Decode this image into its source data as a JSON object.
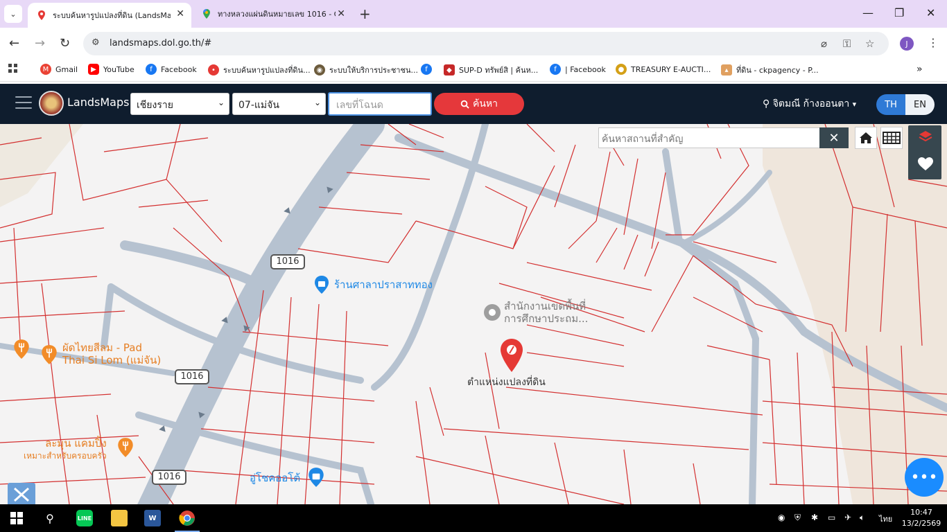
{
  "browser": {
    "tabs": [
      {
        "title": "ระบบค้นหารูปแปลงที่ดิน (LandsMap",
        "active": true
      },
      {
        "title": "ทางหลวงแผ่นดินหมายเลข 1016 - G",
        "active": false
      }
    ],
    "url": "landsmaps.dol.go.th/#",
    "profile_initial": "J"
  },
  "bookmarks": [
    {
      "label": "Gmail",
      "icon": "gmail-icon"
    },
    {
      "label": "YouTube",
      "icon": "youtube-icon"
    },
    {
      "label": "Facebook",
      "icon": "facebook-icon"
    },
    {
      "label": "ระบบค้นหารูปแปลงที่ดิน...",
      "icon": "map-pin-icon"
    },
    {
      "label": "ระบบให้บริการประชาชน...",
      "icon": "seal-icon"
    },
    {
      "label": "",
      "icon": "facebook-icon"
    },
    {
      "label": "SUP-D ทรัพย์สิ | ค้นห...",
      "icon": "sup-icon"
    },
    {
      "label": "| Facebook",
      "icon": "facebook-icon"
    },
    {
      "label": "TREASURY E-AUCTI...",
      "icon": "treasury-icon"
    },
    {
      "label": "ที่ดิน - ckpagency - P...",
      "icon": "ck-icon"
    }
  ],
  "app": {
    "brand": "LandsMaps",
    "province": "เชียงราย",
    "district": "07-แม่จัน",
    "deed_placeholder": "เลขที่โฉนด",
    "search_label": "ค้นหา",
    "user_name": "จิตมณี ก้างออนตา",
    "lang_th": "TH",
    "lang_en": "EN"
  },
  "map": {
    "place_search_placeholder": "ค้นหาสถานที่สำคัญ",
    "road_shields": [
      "1016",
      "1016",
      "1016"
    ],
    "pois": [
      {
        "name": "ร้านศาลาปราสาททอง",
        "color": "#1e88e5"
      },
      {
        "name_line1": "สำนักงานเขตพื้นที่",
        "name_line2": "การศึกษาประถม...",
        "color": "#7a7a7a"
      },
      {
        "name_line1": "ผัดไทยสีลม - Pad",
        "name_line2": "Thai Si Lom (แม่จัน)",
        "color": "#e67e22"
      },
      {
        "name_line1": "ละมุน แคมปิ้ง",
        "name_line2": "เหมาะสำหรับครอบครัว",
        "color": "#e67e22"
      },
      {
        "name": "อู่โชคออโต้",
        "color": "#1e88e5"
      }
    ],
    "parcel_label": "ตำแหน่งแปลงที่ดิน",
    "parcel_color": "#e53935",
    "road_color": "#b6c2d0",
    "boundary_color": "#d32f2f"
  },
  "taskbar": {
    "time": "10:47",
    "date": "13/2/2569",
    "ime": "ไทย"
  }
}
